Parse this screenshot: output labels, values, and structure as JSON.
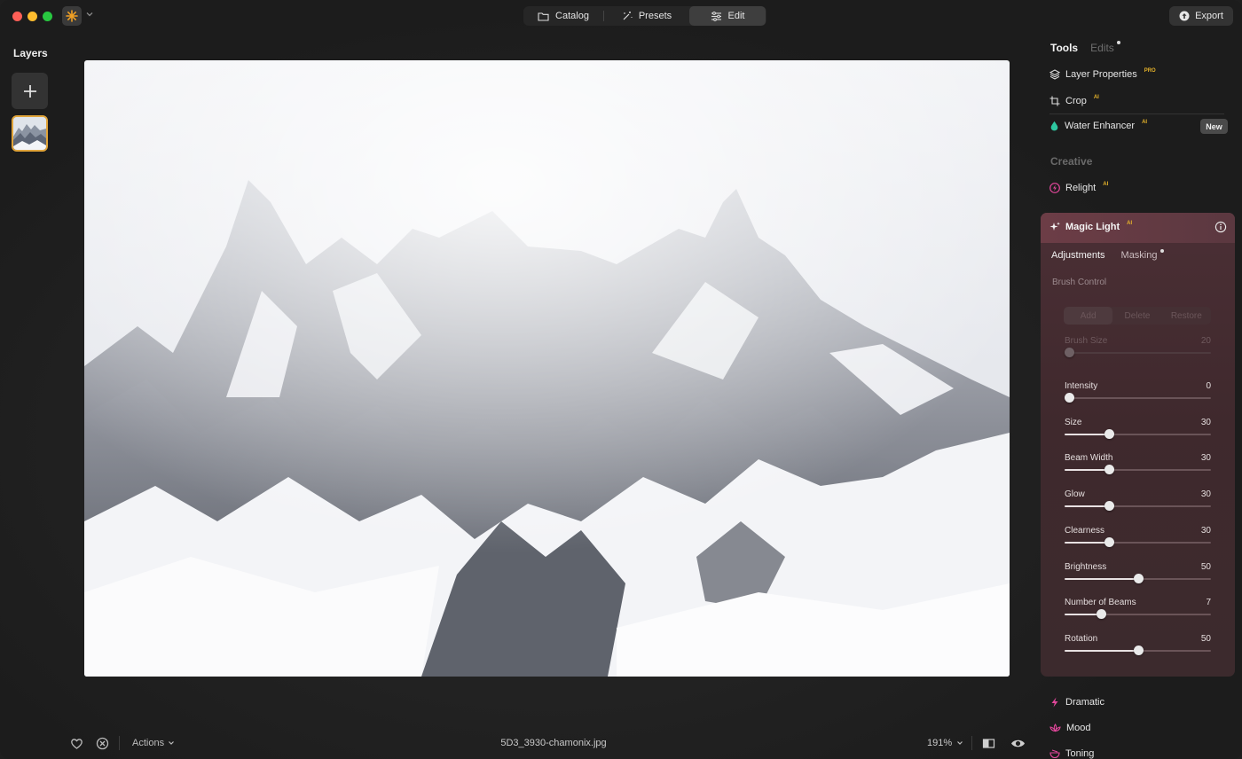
{
  "titlebar": {
    "tabs": [
      {
        "label": "Catalog",
        "icon": "folder-icon"
      },
      {
        "label": "Presets",
        "icon": "magic-wand-icon"
      },
      {
        "label": "Edit",
        "icon": "sliders-icon",
        "active": true
      }
    ],
    "export_label": "Export"
  },
  "layers": {
    "title": "Layers",
    "thumbnail_selected": true
  },
  "bottom_bar": {
    "actions_label": "Actions",
    "filename": "5D3_3930-chamonix.jpg",
    "zoom": "191%"
  },
  "panel": {
    "tabs": {
      "tools": "Tools",
      "edits": "Edits"
    },
    "tools": [
      {
        "label": "Layer Properties",
        "badge": "PRO",
        "icon": "layers-icon"
      },
      {
        "label": "Crop",
        "badge": "AI",
        "icon": "crop-icon"
      },
      {
        "label": "Water Enhancer",
        "badge": "AI",
        "icon": "water-drop-icon",
        "new_label": "New"
      }
    ],
    "creative_label": "Creative",
    "relight": {
      "label": "Relight",
      "badge": "AI"
    },
    "magic_light": {
      "title": "Magic Light",
      "badge": "AI",
      "subtabs": {
        "adjustments": "Adjustments",
        "masking": "Masking"
      },
      "brush_control": "Brush Control",
      "brush_modes": [
        "Add",
        "Delete",
        "Restore"
      ],
      "brush_size": {
        "label": "Brush Size",
        "value": "20"
      },
      "sliders": [
        {
          "label": "Intensity",
          "value": "0",
          "fraction": 0.0
        },
        {
          "label": "Size",
          "value": "30",
          "fraction": 0.3
        },
        {
          "label": "Beam Width",
          "value": "30",
          "fraction": 0.3
        },
        {
          "label": "Glow",
          "value": "30",
          "fraction": 0.3
        },
        {
          "label": "Clearness",
          "value": "30",
          "fraction": 0.3
        },
        {
          "label": "Brightness",
          "value": "50",
          "fraction": 0.5
        },
        {
          "label": "Number of Beams",
          "value": "7",
          "fraction": 0.25
        },
        {
          "label": "Rotation",
          "value": "50",
          "fraction": 0.5
        }
      ]
    },
    "bottom_tools": [
      {
        "label": "Dramatic",
        "icon": "bolt-icon"
      },
      {
        "label": "Mood",
        "icon": "lotus-icon"
      },
      {
        "label": "Toning",
        "icon": "bowl-icon"
      }
    ]
  },
  "colors": {
    "accent": "#e0a43a",
    "magic_light_header": "#6c3d46",
    "pink_icon": "#e2479b",
    "water_icon": "#2ec7a0"
  }
}
